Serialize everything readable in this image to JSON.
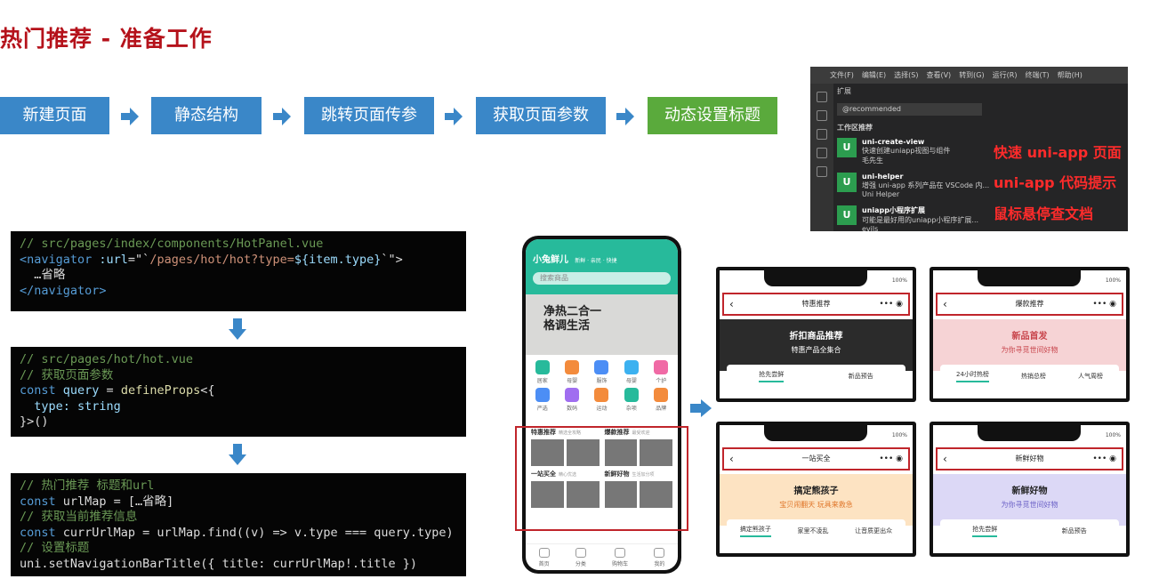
{
  "slide": {
    "title": "热门推荐 - 准备工作"
  },
  "steps": [
    "新建页面",
    "静态结构",
    "跳转页面传参",
    "获取页面参数",
    "动态设置标题"
  ],
  "code1": {
    "l1": "// src/pages/index/components/HotPanel.vue",
    "tag_open": "<navigator",
    "attr": " :url",
    "eq": "=\"`",
    "str": "/pages/hot/hot?type=",
    "interp": "${item.type}",
    "end": "`\">",
    "l3": "  …省略",
    "tag_close": "</navigator>"
  },
  "code2": {
    "l1": "// src/pages/hot/hot.vue",
    "l2": "// 获取页面参数",
    "kw": "const",
    "var": " query",
    "eq": " = ",
    "fn": "defineProps",
    "rest": "<{",
    "l4": "  type: string",
    "l5": "}>()"
  },
  "code3": {
    "l1": "// 热门推荐 标题和url",
    "kw": "const",
    "l2rest": " urlMap = […省略]",
    "l3": "// 获取当前推荐信息",
    "l4rest": " currUrlMap = urlMap.find((v) => v.type === query.type)",
    "l5": "// 设置标题",
    "l6": "uni.setNavigationBarTitle({ title: currUrlMap!.title })"
  },
  "vscode": {
    "menu": [
      "文件(F)",
      "编辑(E)",
      "选择(S)",
      "查看(V)",
      "转到(G)",
      "运行(R)",
      "终端(T)",
      "帮助(H)"
    ],
    "panel_title": "扩展",
    "search": "@recommended",
    "section": "工作区推荐",
    "exts": [
      {
        "name": "uni-create-view",
        "desc": "快速创建uniapp视图与组件",
        "author": "毛先生",
        "logo": "U"
      },
      {
        "name": "uni-helper",
        "desc": "增强 uni-app 系列产品在 VSCode 内...",
        "author": "Uni Helper",
        "logo": "U"
      },
      {
        "name": "uniapp小程序扩展",
        "desc": "可能是最好用的uniapp小程序扩展...",
        "author": "evils",
        "logo": "U"
      }
    ],
    "notes": [
      "快速 uni-app 页面",
      "uni-app 代码提示",
      "鼠标悬停查文档"
    ]
  },
  "phone": {
    "brand": "小兔鲜儿",
    "tags": "新鲜 · 亲民 · 快捷",
    "search": "搜索商品",
    "banner": [
      "净热二合一",
      "格调生活"
    ],
    "cats": [
      "居家",
      "母婴",
      "服饰",
      "母婴",
      "个护",
      "严选",
      "数码",
      "运动",
      "杂项",
      "品牌"
    ],
    "hot": [
      {
        "t": "特惠推荐",
        "s": "精选全攻略"
      },
      {
        "t": "爆款推荐",
        "s": "最受欢迎"
      },
      {
        "t": "一站买全",
        "s": "精心优选"
      },
      {
        "t": "新鲜好物",
        "s": "生活加分项"
      }
    ],
    "tabbar": [
      "首页",
      "分类",
      "购物车",
      "我的"
    ]
  },
  "screens": [
    {
      "title": "特惠推荐",
      "ban1": "折扣商品推荐",
      "ban2": "特惠产品全集合",
      "tabs": [
        "抢先尝鲜",
        "新品预告"
      ],
      "bg": "#2b2b2b",
      "fg": "#ffffff"
    },
    {
      "title": "爆款推荐",
      "ban1": "新品首发",
      "ban2": "为你寻觅世间好物",
      "tabs": [
        "24小时热榜",
        "热销总榜",
        "人气周榜"
      ],
      "bg": "#f6d3d5",
      "fg": "#c8454c"
    },
    {
      "title": "一站买全",
      "ban1": "搞定熊孩子",
      "ban2": "宝贝闹翻天 玩具来救急",
      "tabs": [
        "搞定熊孩子",
        "家里不凌乱",
        "让音质更出众"
      ],
      "bg": "#fde3c2",
      "fg": "#e0762a"
    },
    {
      "title": "新鲜好物",
      "ban1": "新鲜好物",
      "ban2": "为你寻觅世间好物",
      "tabs": [
        "抢先尝鲜",
        "新品预告"
      ],
      "bg": "#dcd8f6",
      "fg": "#6a60c6"
    }
  ],
  "pct": "100%"
}
